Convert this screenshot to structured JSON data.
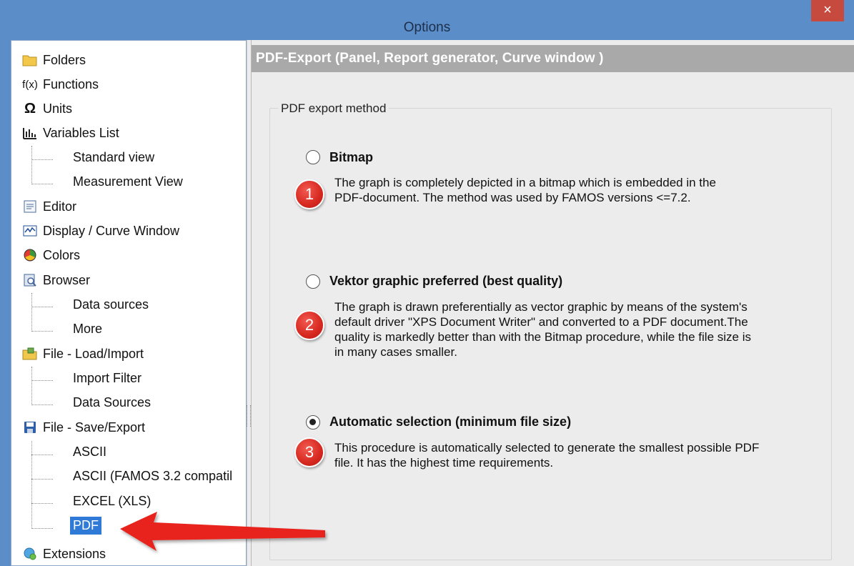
{
  "window": {
    "title": "Options",
    "close_glyph": "×"
  },
  "sidebar": {
    "items": [
      {
        "label": "Folders",
        "icon": "folder-icon",
        "type": "root"
      },
      {
        "label": "Functions",
        "icon": "function-icon",
        "glyph": "f(x)",
        "type": "root"
      },
      {
        "label": "Units",
        "icon": "omega-icon",
        "glyph": "Ω",
        "type": "root"
      },
      {
        "label": "Variables List",
        "icon": "variables-icon",
        "type": "root"
      },
      {
        "label": "Standard view",
        "type": "child"
      },
      {
        "label": "Measurement View",
        "type": "child"
      },
      {
        "label": "Editor",
        "icon": "editor-icon",
        "type": "root"
      },
      {
        "label": "Display / Curve Window",
        "icon": "curve-window-icon",
        "type": "root"
      },
      {
        "label": "Colors",
        "icon": "colors-icon",
        "type": "root"
      },
      {
        "label": "Browser",
        "icon": "browser-icon",
        "type": "root"
      },
      {
        "label": "Data sources",
        "type": "child"
      },
      {
        "label": "More",
        "type": "child"
      },
      {
        "label": "File - Load/Import",
        "icon": "load-import-icon",
        "type": "root"
      },
      {
        "label": "Import Filter",
        "type": "child"
      },
      {
        "label": "Data Sources",
        "type": "child"
      },
      {
        "label": "File - Save/Export",
        "icon": "save-icon",
        "type": "root"
      },
      {
        "label": "ASCII",
        "type": "child"
      },
      {
        "label": "ASCII (FAMOS 3.2 compatil",
        "type": "child"
      },
      {
        "label": "EXCEL (XLS)",
        "type": "child"
      },
      {
        "label": "PDF",
        "type": "child",
        "selected": true
      },
      {
        "label": "Extensions",
        "icon": "extensions-icon",
        "type": "root"
      }
    ]
  },
  "main": {
    "header": "PDF-Export (Panel, Report generator, Curve window )",
    "group_title": "PDF export method",
    "options": [
      {
        "label": "Bitmap",
        "checked": false,
        "badge": "1",
        "desc_lines": [
          "The graph is completely depicted in a bitmap which is embedded in the",
          "PDF-document. The method was used by FAMOS versions <=7.2."
        ]
      },
      {
        "label": "Vektor graphic preferred (best quality)",
        "checked": false,
        "badge": "2",
        "desc_lines": [
          "The graph is drawn preferentially as vector graphic by means of the system's",
          "default driver \"XPS Document Writer\" and converted to a PDF document.The",
          "quality is markedly better than with the Bitmap procedure, while the file size is",
          "in many cases smaller."
        ]
      },
      {
        "label": "Automatic selection (minimum file size)",
        "checked": true,
        "badge": "3",
        "desc_lines": [
          "This procedure is automatically selected to generate the smallest possible PDF",
          "file. It has the highest time requirements."
        ]
      }
    ]
  },
  "colors": {
    "titlebar": "#5b8ec9",
    "close": "#c74a3f",
    "selection": "#2e7ad6",
    "badge": "#d6281f",
    "arrow": "#e8231b",
    "header": "#a9a9a9"
  }
}
